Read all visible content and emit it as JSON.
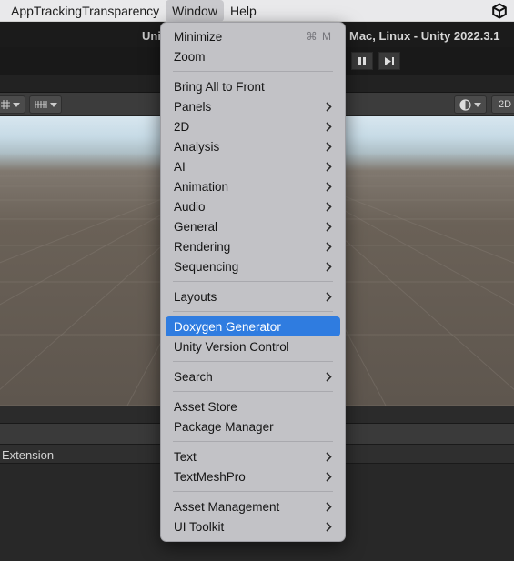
{
  "menubar": {
    "items": [
      {
        "label": "AppTrackingTransparency"
      },
      {
        "label": "Window"
      },
      {
        "label": "Help"
      }
    ],
    "logo_icon": "unity-logo-icon"
  },
  "window": {
    "title_left": "Uni",
    "title_right": "Mac, Linux - Unity 2022.3.1"
  },
  "toolbar": {
    "pause_icon": "pause-icon",
    "step_icon": "step-icon"
  },
  "scene_toolbar": {
    "mode_2d_label": "2D"
  },
  "panel": {
    "header_label": "Extension"
  },
  "menu": {
    "highlight_color": "#2f7ce0",
    "items": [
      {
        "label": "Minimize",
        "shortcut": "⌘ M"
      },
      {
        "label": "Zoom"
      },
      {
        "label": "Bring All to Front"
      },
      {
        "label": "Panels"
      },
      {
        "label": "2D"
      },
      {
        "label": "Analysis"
      },
      {
        "label": "AI"
      },
      {
        "label": "Animation"
      },
      {
        "label": "Audio"
      },
      {
        "label": "General"
      },
      {
        "label": "Rendering"
      },
      {
        "label": "Sequencing"
      },
      {
        "label": "Layouts"
      },
      {
        "label": "Doxygen Generator"
      },
      {
        "label": "Unity Version Control"
      },
      {
        "label": "Search"
      },
      {
        "label": "Asset Store"
      },
      {
        "label": "Package Manager"
      },
      {
        "label": "Text"
      },
      {
        "label": "TextMeshPro"
      },
      {
        "label": "Asset Management"
      },
      {
        "label": "UI Toolkit"
      }
    ]
  }
}
